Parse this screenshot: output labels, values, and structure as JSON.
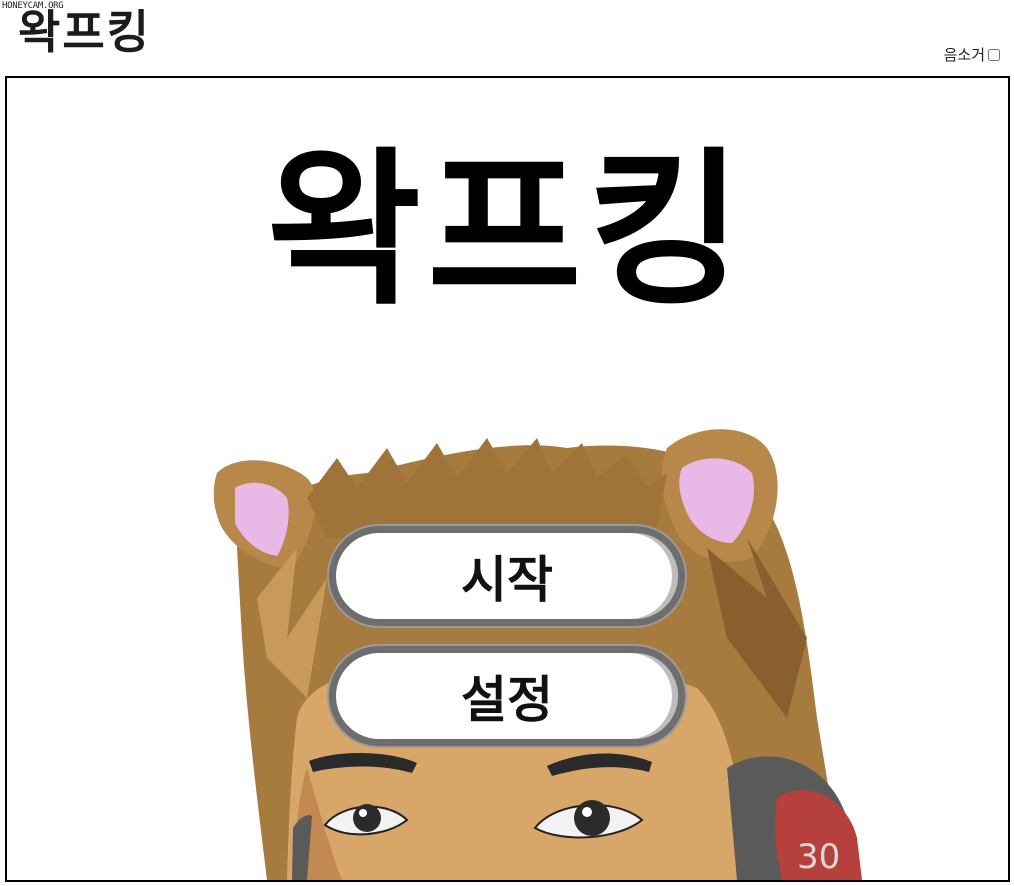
{
  "watermark": "HONEYCAM.ORG",
  "header": {
    "logo": "왁프킹",
    "mute_label": "음소거",
    "mute_checked": false
  },
  "game": {
    "title": "왁프킹",
    "menu": {
      "start_label": "시작",
      "settings_label": "설정"
    },
    "mascot": {
      "headphone_text": "30",
      "colors": {
        "hair": "#a77a3e",
        "skin": "#d9a66a",
        "ear_inner": "#e8b8e6",
        "headphone": "#5a5a5a",
        "headphone_accent": "#b5403c"
      }
    }
  }
}
